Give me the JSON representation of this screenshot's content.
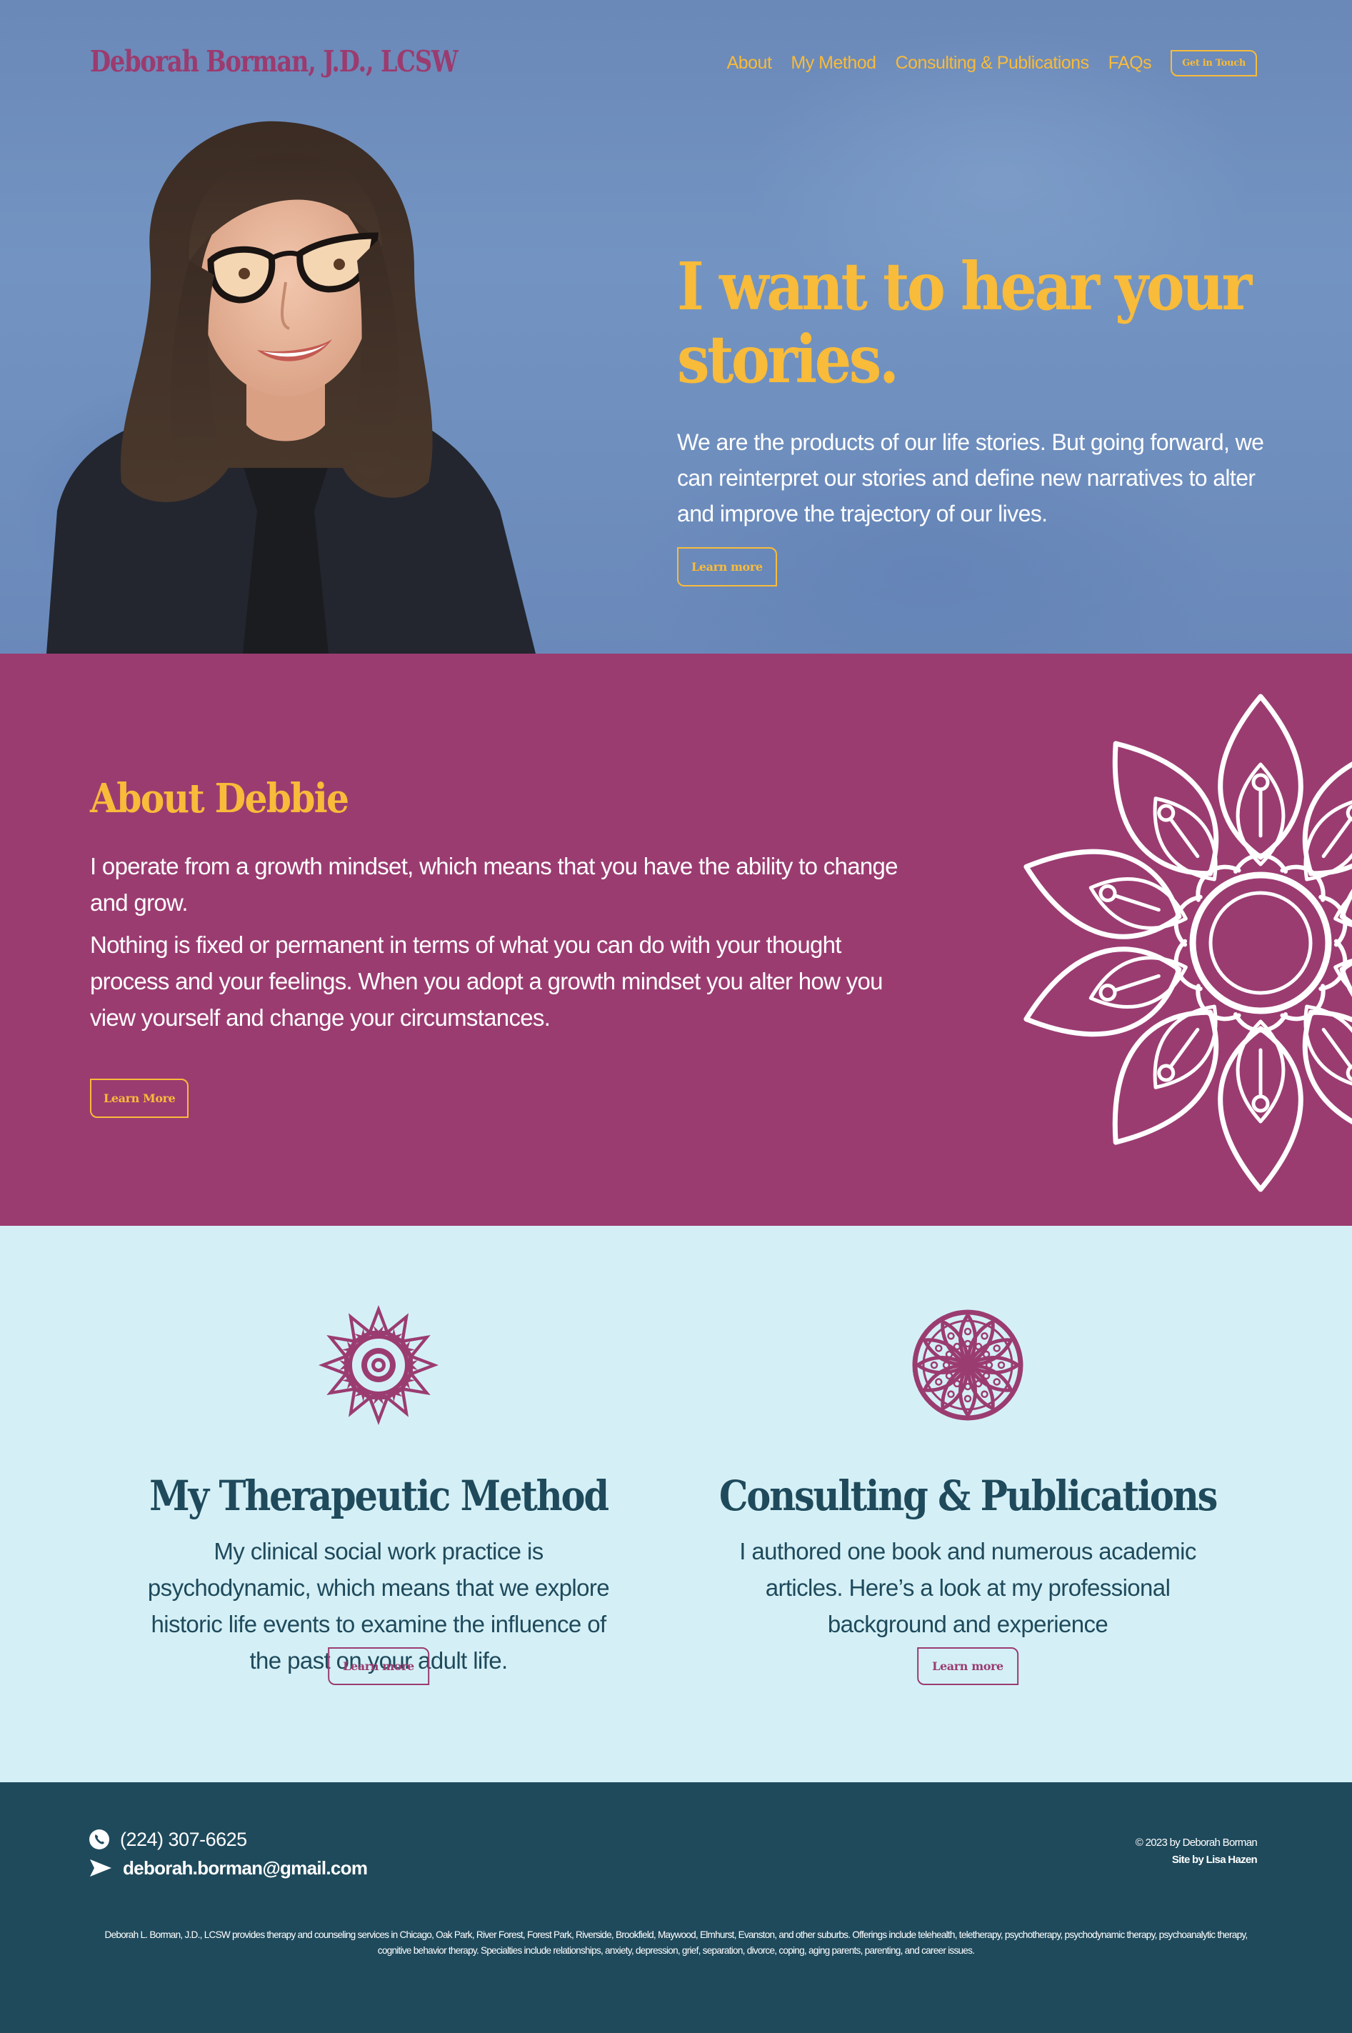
{
  "colors": {
    "hero_bg": "#6e8dbd",
    "brand_magenta": "#9b3c71",
    "accent_yellow": "#f8bb3a",
    "light_cyan": "#d4f0f6",
    "footer_teal": "#1f4a5c",
    "white": "#ffffff"
  },
  "header": {
    "brand": "Deborah Borman, J.D., LCSW",
    "nav": [
      {
        "label": "About"
      },
      {
        "label": "My Method"
      },
      {
        "label": "Consulting & Publications"
      },
      {
        "label": "FAQs"
      }
    ],
    "cta_label": "Get in Touch"
  },
  "hero": {
    "portrait_alt": "Portrait of Deborah Borman",
    "title": "I want to hear your stories.",
    "text": "We are the products of our life stories. But going forward, we can reinterpret our stories and define new narratives to alter and improve the trajectory of our lives.",
    "button_label": "Learn more"
  },
  "about": {
    "heading": "About Debbie",
    "paragraphs": [
      "I operate from a growth mindset, which means that you have the ability to change and grow.",
      "Nothing is fixed or permanent in terms of what you can do with your thought process and your feelings. When you adopt a growth mindset you alter how you view yourself and change your circumstances."
    ],
    "button_label": "Learn More",
    "decoration_icon": "mandala-icon"
  },
  "services": [
    {
      "icon": "lotus-mandala-icon",
      "heading": "My Therapeutic Method",
      "text": "My clinical social work practice is psychodynamic, which means that we explore historic life events to examine the influence of the past on your adult life.",
      "button_label": "Learn more"
    },
    {
      "icon": "circle-mandala-icon",
      "heading": "Consulting & Publications",
      "text": "I authored one book and numerous academic articles. Here’s a look at my professional background and experience",
      "button_label": "Learn more"
    }
  ],
  "footer": {
    "phone_icon": "phone-icon",
    "phone": "(224) 307-6625",
    "email_icon": "send-icon",
    "email": "deborah.borman@gmail.com",
    "copyright": "© 2023 by Deborah Borman",
    "credit": "Site by Lisa Hazen",
    "seo_text": "Deborah L. Borman, J.D., LCSW provides therapy and counseling services in Chicago, Oak Park, River Forest, Forest Park, Riverside, Brookfield, Maywood, Elmhurst, Evanston, and other suburbs. Offerings include telehealth, teletherapy, psychotherapy, psychodynamic therapy, psychoanalytic therapy, cognitive behavior therapy. Specialties include relationships, anxiety, depression, grief, separation, divorce, coping, aging parents, parenting,  and career issues."
  }
}
